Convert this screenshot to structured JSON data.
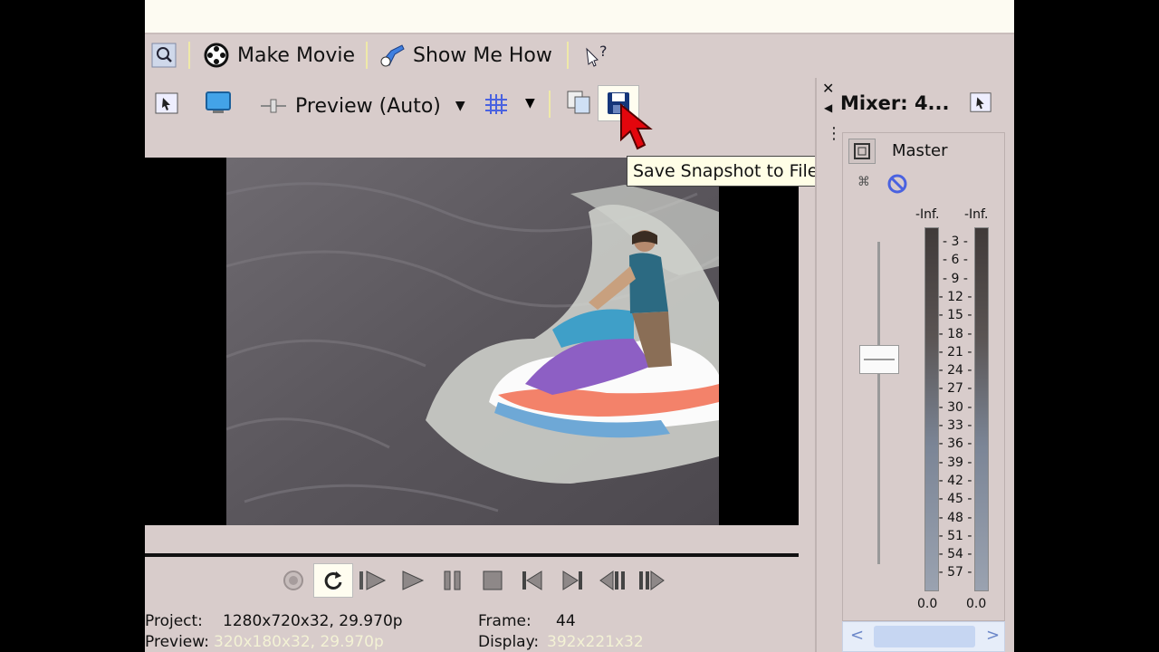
{
  "toolbar": {
    "make_movie": "Make Movie",
    "show_me_how": "Show Me How"
  },
  "preview_toolbar": {
    "preview_mode": "Preview (Auto)"
  },
  "tooltip": {
    "text": "Save Snapshot to File..."
  },
  "mixer": {
    "title": "Mixer: 4...",
    "master_label": "Master",
    "peak_left": "-Inf.",
    "peak_right": "-Inf.",
    "scale": [
      "3",
      "6",
      "9",
      "12",
      "15",
      "18",
      "21",
      "24",
      "27",
      "30",
      "33",
      "36",
      "39",
      "42",
      "45",
      "48",
      "51",
      "54",
      "57"
    ],
    "value_left": "0.0",
    "value_right": "0.0"
  },
  "info": {
    "project_label": "Project:",
    "project_value": "1280x720x32, 29.970p",
    "preview_label": "Preview:",
    "preview_value": "320x180x32, 29.970p",
    "frame_label": "Frame:",
    "frame_value": "44",
    "display_label": "Display:",
    "display_value": "392x221x32"
  },
  "colors": {
    "panel_bg": "#d8cccb",
    "tooltip_bg": "#fffee6",
    "cursor_red": "#e3060d"
  }
}
